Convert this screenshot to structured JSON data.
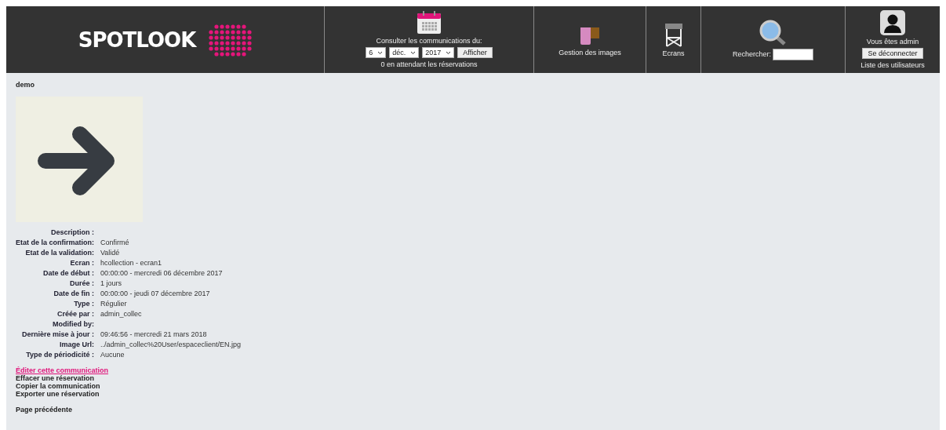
{
  "header": {
    "logo": "SPOTLOOK",
    "date_panel": {
      "label": "Consulter les communications du:",
      "day": "6",
      "month": "déc.",
      "year": "2017",
      "button": "Afficher",
      "pending": "0 en attendant les réservations"
    },
    "images": {
      "label": "Gestion des images"
    },
    "screens": {
      "label": "Ecrans"
    },
    "search": {
      "label": "Rechercher:"
    },
    "user": {
      "status": "Vous êtes admin",
      "logout": "Se déconnecter",
      "users_link": "Liste des utilisateurs"
    }
  },
  "page_title": "demo",
  "details": [
    {
      "label": "Description :"
    },
    {
      "label": "Etat de la confirmation:",
      "value": "Confirmé"
    },
    {
      "label": "Etat de la validation:",
      "value": "Validé"
    },
    {
      "label": "Ecran :",
      "value": "hcollection - ecran1"
    },
    {
      "label": "Date de début :",
      "value": "00:00:00 - mercredi 06 décembre 2017"
    },
    {
      "label": "Durée :",
      "value": "1 jours"
    },
    {
      "label": "Date de fin :",
      "value": "00:00:00 - jeudi 07 décembre 2017"
    },
    {
      "label": "Type :",
      "value": "Régulier"
    },
    {
      "label": "Créée par :",
      "value": "admin_collec"
    },
    {
      "label": "Modified by:"
    },
    {
      "label": "Dernière mise à jour :",
      "value": "09:46:56 - mercredi 21 mars 2018"
    },
    {
      "label": "Image Url:",
      "value": "../admin_collec%20User/espaceclient/EN.jpg"
    },
    {
      "label": "Type de périodicité :",
      "value": "Aucune"
    }
  ],
  "actions": [
    {
      "label": "Éditer cette communication",
      "highlighted": true
    },
    {
      "label": "Effacer une réservation",
      "highlighted": false
    },
    {
      "label": "Copier la communication",
      "highlighted": false
    },
    {
      "label": "Exporter une réservation",
      "highlighted": false
    }
  ],
  "back_link": "Page précédente"
}
